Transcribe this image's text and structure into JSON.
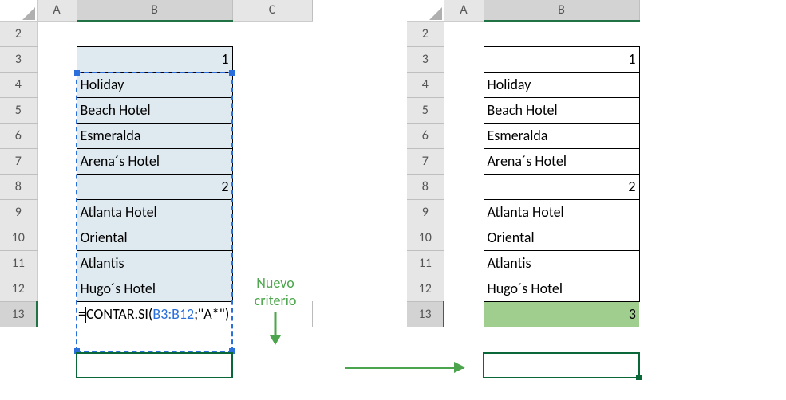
{
  "columns": [
    "A",
    "B",
    "C"
  ],
  "columns2": [
    "A",
    "B"
  ],
  "rowNumbers": [
    2,
    3,
    4,
    5,
    6,
    7,
    8,
    9,
    10,
    11,
    12,
    13
  ],
  "left": {
    "cells": {
      "B3": "1",
      "B4": "Holiday",
      "B5": "Beach Hotel",
      "B6": "Esmeralda",
      "B7": "Arena´s Hotel",
      "B8": "2",
      "B9": "Atlanta Hotel",
      "B10": "Oriental",
      "B11": "Atlantis",
      "B12": "Hugo´s Hotel"
    },
    "formula": {
      "prefix": "=",
      "funcName": "CONTAR.SI(",
      "range": "B3:B12",
      "sep": ";",
      "arg": "\"A*\"",
      "close": ")"
    }
  },
  "right": {
    "cells": {
      "B3": "1",
      "B4": "Holiday",
      "B5": "Beach Hotel",
      "B6": "Esmeralda",
      "B7": "Arena´s Hotel",
      "B8": "2",
      "B9": "Atlanta Hotel",
      "B10": "Oriental",
      "B11": "Atlantis",
      "B12": "Hugo´s Hotel",
      "B13": "3"
    }
  },
  "annotation": {
    "line1": "Nuevo",
    "line2": "criterio"
  }
}
